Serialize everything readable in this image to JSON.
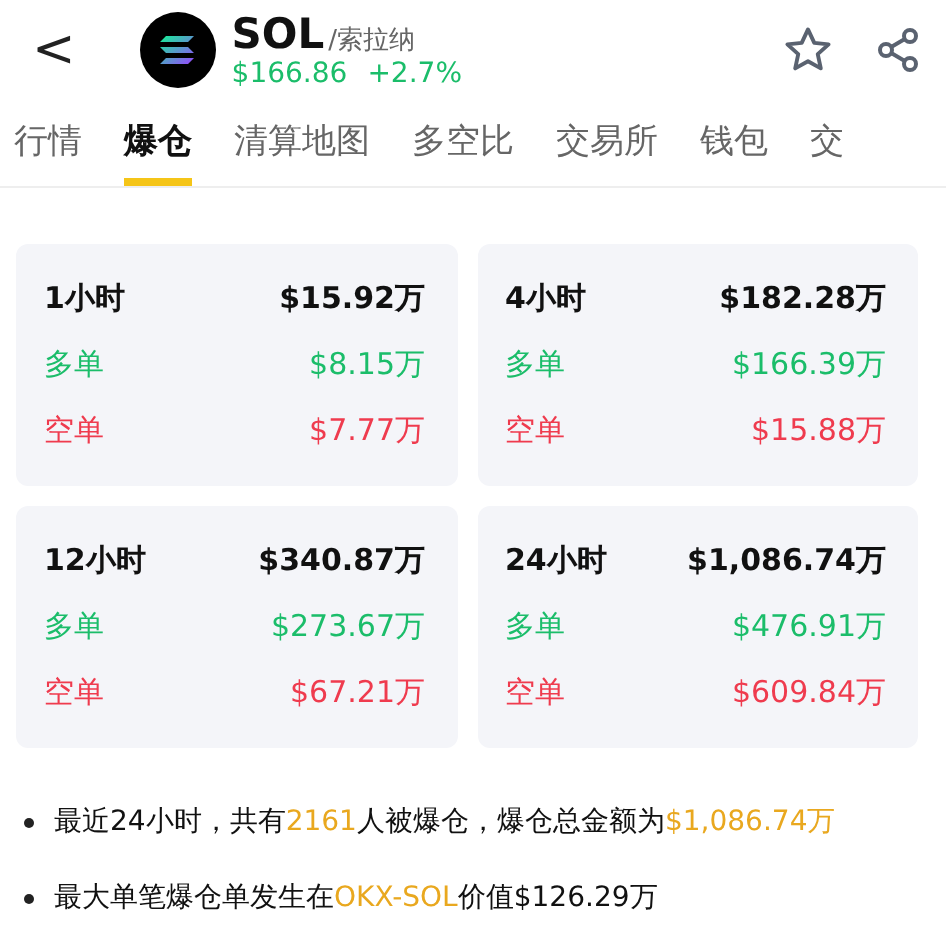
{
  "header": {
    "back": "<",
    "symbol": "SOL",
    "name": "/索拉纳",
    "price": "$166.86",
    "change": "+2.7%"
  },
  "tabs": [
    {
      "label": "行情",
      "selected": false
    },
    {
      "label": "爆仓",
      "selected": true
    },
    {
      "label": "清算地图",
      "selected": false
    },
    {
      "label": "多空比",
      "selected": false
    },
    {
      "label": "交易所",
      "selected": false
    },
    {
      "label": "钱包",
      "selected": false
    },
    {
      "label": "交",
      "selected": false
    }
  ],
  "cards": [
    {
      "period": "1小时",
      "total": "$15.92万",
      "rows": [
        {
          "kind": "long",
          "label": "多单",
          "value": "$8.15万"
        },
        {
          "kind": "short",
          "label": "空单",
          "value": "$7.77万"
        }
      ]
    },
    {
      "period": "4小时",
      "total": "$182.28万",
      "rows": [
        {
          "kind": "long",
          "label": "多单",
          "value": "$166.39万"
        },
        {
          "kind": "short",
          "label": "空单",
          "value": "$15.88万"
        }
      ]
    },
    {
      "period": "12小时",
      "total": "$340.87万",
      "rows": [
        {
          "kind": "long",
          "label": "多单",
          "value": "$273.67万"
        },
        {
          "kind": "short",
          "label": "空单",
          "value": "$67.21万"
        }
      ]
    },
    {
      "period": "24小时",
      "total": "$1,086.74万",
      "rows": [
        {
          "kind": "long",
          "label": "多单",
          "value": "$476.91万"
        },
        {
          "kind": "short",
          "label": "空单",
          "value": "$609.84万"
        }
      ]
    }
  ],
  "notes": [
    [
      {
        "text": "最近24小时，共有",
        "highlight": false
      },
      {
        "text": "2161",
        "highlight": true
      },
      {
        "text": "人被爆仓，爆仓总金额为",
        "highlight": false
      },
      {
        "text": "$1,086.74万",
        "highlight": true
      }
    ],
    [
      {
        "text": "最大单笔爆仓单发生在",
        "highlight": false
      },
      {
        "text": "OKX-SOL",
        "highlight": true
      },
      {
        "text": "价值$126.29万",
        "highlight": false
      }
    ]
  ]
}
